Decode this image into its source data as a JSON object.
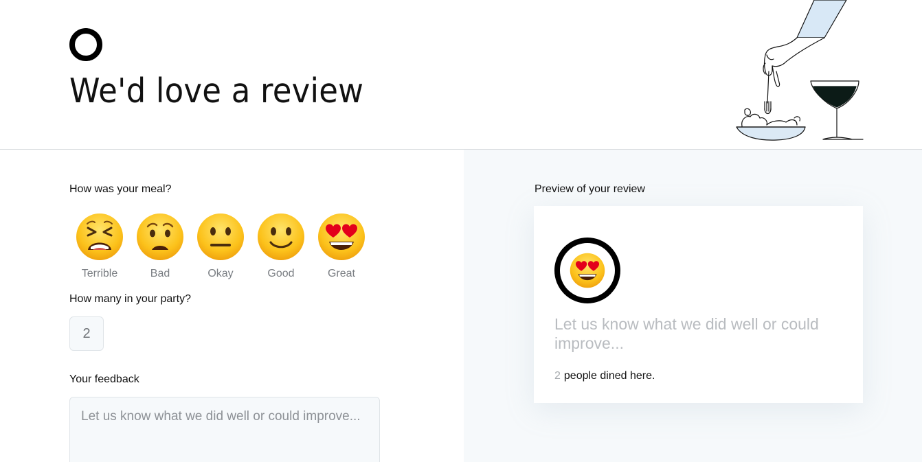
{
  "header": {
    "title": "We'd love a review",
    "logo_icon": "ring-logo-icon",
    "illustration": "dining-hand-fork-wine-illustration"
  },
  "meal": {
    "question": "How was your meal?",
    "options": [
      {
        "label": "Terrible",
        "icon": "tired-face-icon"
      },
      {
        "label": "Bad",
        "icon": "frowning-face-icon"
      },
      {
        "label": "Okay",
        "icon": "neutral-face-icon"
      },
      {
        "label": "Good",
        "icon": "slightly-smiling-face-icon"
      },
      {
        "label": "Great",
        "icon": "heart-eyes-face-icon"
      }
    ],
    "selected": "Great"
  },
  "party": {
    "question": "How many in your party?",
    "value": "2"
  },
  "feedback": {
    "label": "Your feedback",
    "placeholder": "Let us know what we did well or could improve..."
  },
  "preview": {
    "label": "Preview of your review",
    "icon": "heart-eyes-face-icon",
    "text": "Let us know what we did well or could improve...",
    "diners_count": "2",
    "diners_suffix": "people dined here."
  },
  "colors": {
    "right_panel_bg": "#f6f9fb",
    "input_bg": "#f6f9fb",
    "muted_text": "#7a7e83",
    "placeholder_text": "#b9bcc0",
    "accent_black": "#000000"
  }
}
